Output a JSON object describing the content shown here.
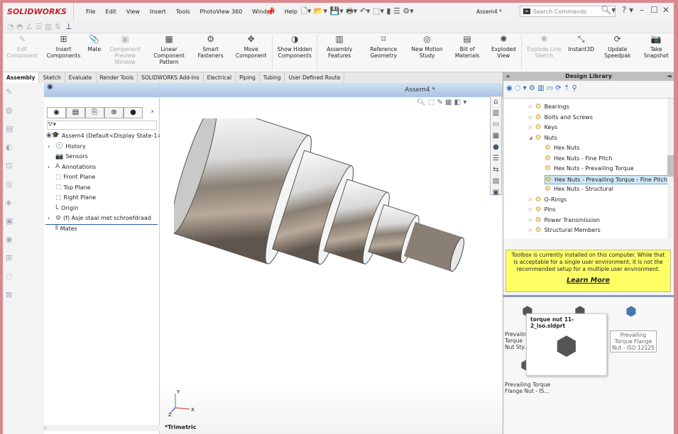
{
  "app": {
    "logo": "SOLIDWORKS",
    "document_title": "Assem4 *",
    "search_placeholder": "Search Commands"
  },
  "menu": [
    "File",
    "Edit",
    "View",
    "Insert",
    "Tools",
    "PhotoView 360",
    "Window",
    "Help"
  ],
  "ribbon": [
    {
      "label": "Edit Component",
      "disabled": true,
      "icon": "edit-component"
    },
    {
      "label": "Insert Components",
      "disabled": false,
      "icon": "insert-components"
    },
    {
      "label": "Mate",
      "disabled": false,
      "icon": "paperclip"
    },
    {
      "label": "Component Preview Window",
      "disabled": true,
      "icon": "preview-window"
    },
    {
      "label": "Linear Component Pattern",
      "disabled": false,
      "icon": "pattern"
    },
    {
      "label": "Smart Fasteners",
      "disabled": false,
      "icon": "fasteners"
    },
    {
      "label": "Move Component",
      "disabled": false,
      "icon": "move"
    },
    {
      "label": "Show Hidden Components",
      "disabled": false,
      "icon": "show-hidden"
    },
    {
      "label": "Assembly Features",
      "disabled": false,
      "icon": "assembly-features"
    },
    {
      "label": "Reference Geometry",
      "disabled": false,
      "icon": "reference-geometry"
    },
    {
      "label": "New Motion Study",
      "disabled": false,
      "icon": "motion-study"
    },
    {
      "label": "Bill of Materials",
      "disabled": false,
      "icon": "bom"
    },
    {
      "label": "Exploded View",
      "disabled": false,
      "icon": "exploded-view"
    },
    {
      "label": "Explode Line Sketch",
      "disabled": true,
      "icon": "explode-line"
    },
    {
      "label": "Instant3D",
      "disabled": false,
      "icon": "instant3d"
    },
    {
      "label": "Update Speedpak",
      "disabled": false,
      "icon": "speedpak"
    },
    {
      "label": "Take Snapshot",
      "disabled": false,
      "icon": "camera"
    }
  ],
  "tabs": [
    "Assembly",
    "Sketch",
    "Evaluate",
    "Render Tools",
    "SOLIDWORKS Add-Ins",
    "Electrical",
    "Piping",
    "Tubing",
    "User Defined Route"
  ],
  "active_tab": "Assembly",
  "tree": {
    "root": "Assem4  (Default<Display State-1>)",
    "items": [
      {
        "label": "History",
        "expandable": true
      },
      {
        "label": "Sensors",
        "expandable": false
      },
      {
        "label": "Annotations",
        "expandable": true
      },
      {
        "label": "Front Plane",
        "expandable": false
      },
      {
        "label": "Top Plane",
        "expandable": false
      },
      {
        "label": "Right Plane",
        "expandable": false
      },
      {
        "label": "Origin",
        "expandable": false
      },
      {
        "label": "(f) Asje staal met schroefdraad",
        "expandable": true
      },
      {
        "label": "Mates",
        "expandable": false
      }
    ]
  },
  "viewport": {
    "view_label": "*Trimetric",
    "triad": {
      "x": "X",
      "y": "Y",
      "z": "Z"
    }
  },
  "library": {
    "title": "Design Library",
    "items": [
      {
        "label": "Bearings",
        "level": 1
      },
      {
        "label": "Bolts and Screws",
        "level": 1
      },
      {
        "label": "Keys",
        "level": 1
      },
      {
        "label": "Nuts",
        "level": 1,
        "expanded": true
      },
      {
        "label": "Hex Nuts",
        "level": 2
      },
      {
        "label": "Hex Nuts - Fine Pitch",
        "level": 2
      },
      {
        "label": "Hex Nuts - Prevailing Torque",
        "level": 2
      },
      {
        "label": "Hex Nuts - Prevailing Torque - Fine Pitch",
        "level": 2,
        "selected": true
      },
      {
        "label": "Hex Nuts - Structural",
        "level": 2
      },
      {
        "label": "O-Rings",
        "level": 1
      },
      {
        "label": "Pins",
        "level": 1
      },
      {
        "label": "Power Transmission",
        "level": 1
      },
      {
        "label": "Structural Members",
        "level": 1
      }
    ],
    "notice": "Toolbox is currently installed on this computer. While that is acceptable for a single user environment, it is not the recommended setup for a multiple user environment.",
    "learn_more": "Learn More",
    "parts": [
      "Prevailing Torque Nut Sty...",
      "",
      "Prevailing Torque Flange Nut - ISO 12125",
      "Prevailing Torque Flange Nut - IS..."
    ],
    "part_cap_1": "Prevailin\nNut Sty",
    "tooltip": "torque nut 11-2_iso.sldprt",
    "selected_color": "#cde6f7"
  }
}
